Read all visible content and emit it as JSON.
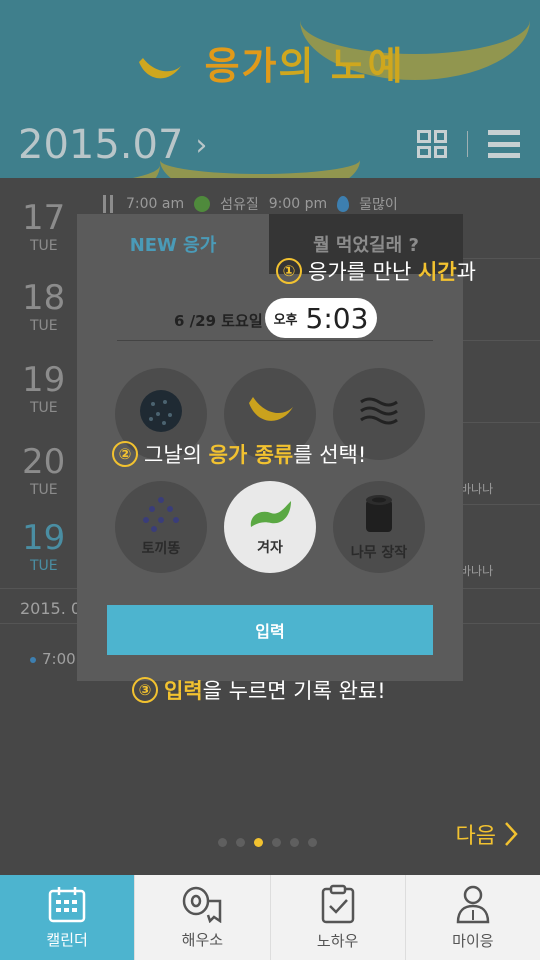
{
  "header": {
    "title_part1": "응가",
    "title_part2": "의 노예",
    "month": "2015.07",
    "month_chevron": "›"
  },
  "calendar": {
    "days": [
      {
        "num": "17",
        "weekday": "TUE"
      },
      {
        "num": "18",
        "weekday": "TUE"
      },
      {
        "num": "19",
        "weekday": "TUE"
      },
      {
        "num": "20",
        "weekday": "TUE"
      },
      {
        "num": "19",
        "weekday": "TUE"
      }
    ],
    "first_row": {
      "time1": "7:00 am",
      "label1": "섬유질",
      "time2": "9:00 pm",
      "label2": "물많이"
    },
    "side_note_1": "바나나",
    "side_note_2": "바나나",
    "date_bar": "2015. 07",
    "time_item": "7:00"
  },
  "modal": {
    "tab_new": "NEW 응가",
    "tab_ate": "뭘 먹었길래 ?",
    "date": "6 /29  토요일",
    "ampm": "오후",
    "time": "5:03",
    "types": [
      {
        "label": "토끼똥",
        "icon": "dots-icon"
      },
      {
        "label": "겨자",
        "icon": "mustard-icon"
      },
      {
        "label": "나무 장작",
        "icon": "log-icon"
      }
    ],
    "input_label": "입력"
  },
  "callouts": {
    "c1_num": "①",
    "c1_pre": "응가를 만난 ",
    "c1_hl": "시간",
    "c1_post": "과",
    "c2_num": "②",
    "c2_pre": "그날의 ",
    "c2_hl": "응가 종류",
    "c2_post": "를 선택!",
    "c3_num": "③",
    "c3_hl": "입력",
    "c3_post": "을 누르면 기록 완료!"
  },
  "pager": {
    "count": 6,
    "active_index": 2
  },
  "next_label": "다음",
  "bottom_nav": [
    {
      "label": "캘린더",
      "icon": "calendar-icon",
      "active": true
    },
    {
      "label": "해우소",
      "icon": "toilet-paper-icon",
      "active": false
    },
    {
      "label": "노하우",
      "icon": "clipboard-icon",
      "active": false
    },
    {
      "label": "마이응",
      "icon": "person-icon",
      "active": false
    }
  ],
  "colors": {
    "accent": "#4db4cf",
    "highlight": "#f2c230"
  }
}
